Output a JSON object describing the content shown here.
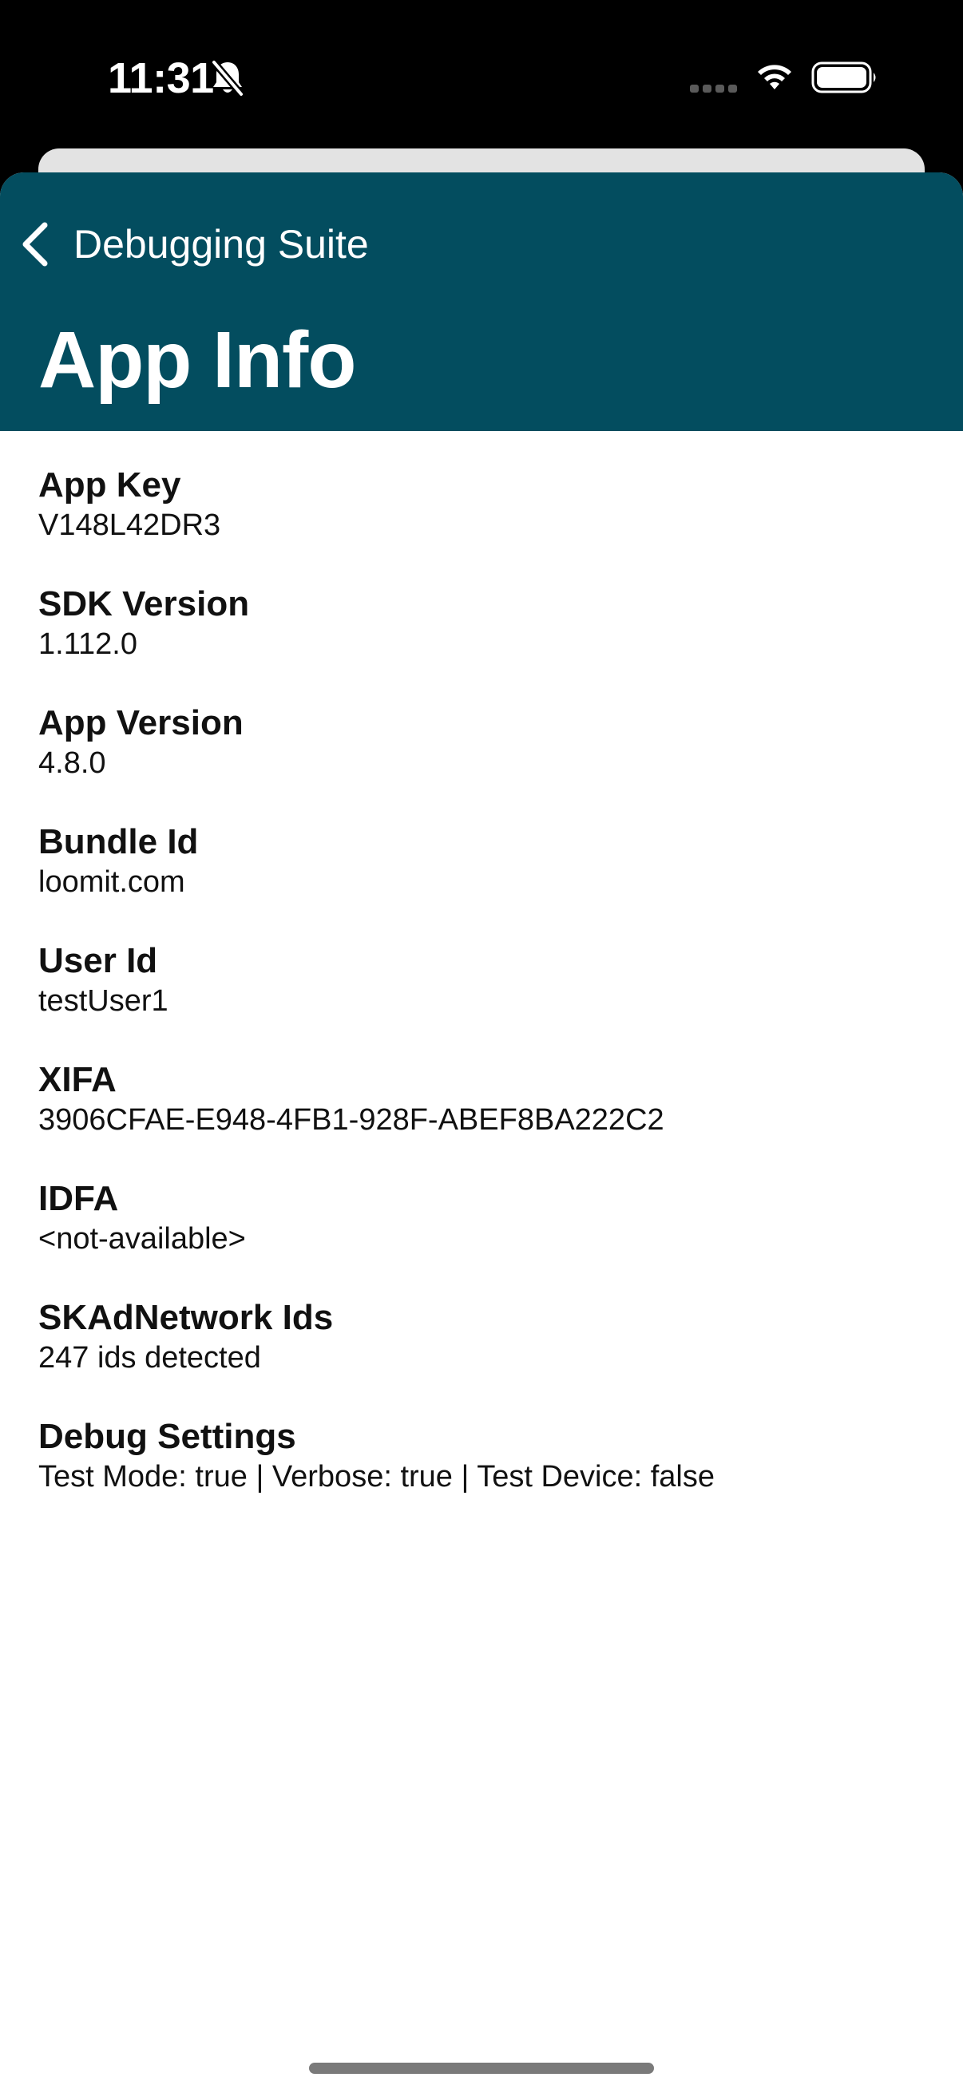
{
  "status_bar": {
    "time": "11:31",
    "icons": [
      "bell-slash-icon",
      "cellular-signal-icon",
      "wifi-icon",
      "battery-icon"
    ]
  },
  "colors": {
    "header_background": "#034d5f",
    "header_text": "#ffffff",
    "body_text": "#111111"
  },
  "nav": {
    "back_label": "Debugging Suite",
    "back_icon": "chevron-left-icon",
    "title": "App Info"
  },
  "info_items": [
    {
      "label": "App Key",
      "value": "V148L42DR3"
    },
    {
      "label": "SDK Version",
      "value": "1.112.0"
    },
    {
      "label": "App Version",
      "value": "4.8.0"
    },
    {
      "label": "Bundle Id",
      "value": "loomit.com"
    },
    {
      "label": "User Id",
      "value": "testUser1"
    },
    {
      "label": "XIFA",
      "value": "3906CFAE-E948-4FB1-928F-ABEF8BA222C2"
    },
    {
      "label": "IDFA",
      "value": "<not-available>"
    },
    {
      "label": "SKAdNetwork Ids",
      "value": "247 ids detected"
    },
    {
      "label": "Debug Settings",
      "value": "Test Mode: true | Verbose: true | Test Device: false"
    }
  ]
}
